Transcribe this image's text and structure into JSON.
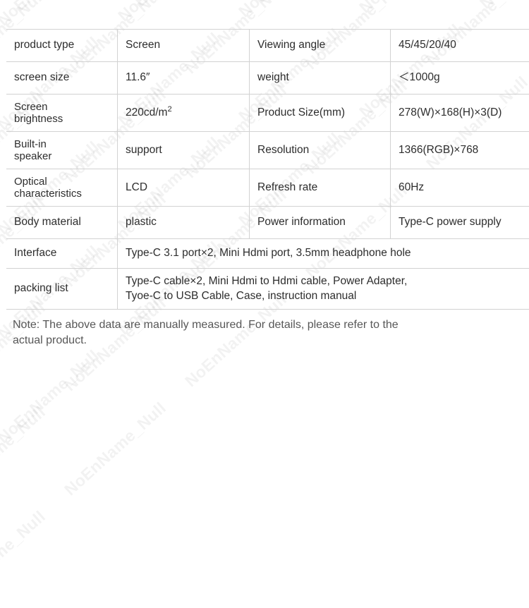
{
  "watermark": {
    "text": "NoEnName_Null",
    "repeat_per_row": 7,
    "rows": 14,
    "color": "#000000",
    "opacity": 0.048,
    "angle_deg": -42
  },
  "table": {
    "border_color": "#d2d2d2",
    "text_color": "#2d2d2d",
    "rows": [
      {
        "type": "quad",
        "label1": "product type",
        "value1": "Screen",
        "label2": "Viewing angle",
        "value2": "45/45/20/40"
      },
      {
        "type": "quad",
        "label1": "screen size",
        "value1": "11.6″",
        "label2": "weight",
        "value2": "＜1000g"
      },
      {
        "type": "quad",
        "label1": "Screen brightness",
        "label1_line1": "Screen",
        "label1_line2": "brightness",
        "value1": "220cd/m²",
        "value1_base": "220cd/m",
        "value1_sup": "2",
        "label2": "Product Size(mm)",
        "value2": "278(W)×168(H)×3(D)"
      },
      {
        "type": "quad",
        "label1": "Built-in speaker",
        "label1_line1": "Built-in",
        "label1_line2": "speaker",
        "value1": "support",
        "label2": "Resolution",
        "value2": "1366(RGB)×768"
      },
      {
        "type": "quad",
        "label1": "Optical characteristics",
        "label1_line1": "Optical",
        "label1_line2": "characteristics",
        "value1": "LCD",
        "label2": "Refresh rate",
        "value2": "60Hz"
      },
      {
        "type": "quad",
        "label1": "Body material",
        "value1": "plastic",
        "label2": "Power information",
        "value2": "Type-C power supply"
      },
      {
        "type": "wide",
        "label1": "Interface",
        "value_span": "Type-C 3.1 port×2,  Mini Hdmi port, 3.5mm headphone hole"
      },
      {
        "type": "wide",
        "label1": "packing list",
        "value_span_line1": "Type-C cable×2,  Mini Hdmi to Hdmi cable, Power Adapter,",
        "value_span_line2": "Tyoe-C to USB Cable, Case,  instruction manual"
      }
    ]
  },
  "note": {
    "line1": "Note: The above data are manually measured. For details, please refer to the",
    "line2": "actual product.",
    "color": "#575757"
  }
}
